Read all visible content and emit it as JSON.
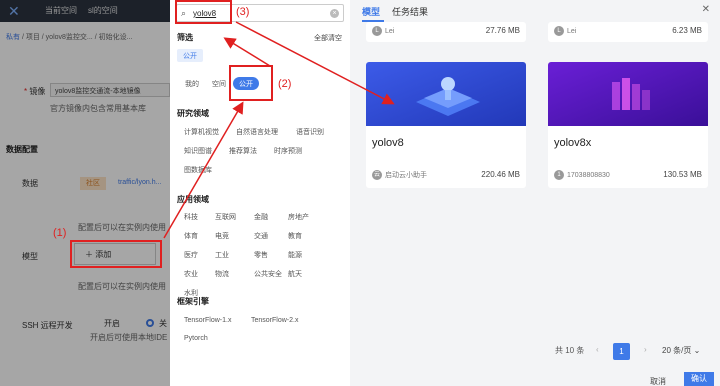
{
  "background": {
    "topnav": [
      "当前空间",
      "sl的空间"
    ],
    "breadcrumb": [
      "私有",
      "/ 项目",
      "/ yolov8监控交...",
      "/ 初始化设..."
    ],
    "image_label": "镜像",
    "image_value": "yolov8监控交通流-本地镜像",
    "image_hint": "官方镜像内包含常用基本库",
    "section_title": "数据配置",
    "data_label": "数据",
    "data_tag": "社区",
    "data_link": "traffic/lyon.h...",
    "data_hint": "配置后可以在实例内使用",
    "model_label": "模型",
    "model_add": "添加",
    "model_hint": "配置后可以在实例内使用",
    "ssh_label": "SSH 远程开发",
    "ssh_option": "开启",
    "ssh_option2": "关",
    "ssh_hint": "开启后可使用本地IDE"
  },
  "filter": {
    "search_value": "yolov8",
    "section_title": "筛选",
    "clear_all": "全部清空",
    "selected_chip": "公开",
    "scope_options": [
      "我的",
      "空间",
      "公开"
    ],
    "research_title": "研究领域",
    "research_items": [
      "计算机视觉",
      "自然语言处理",
      "语音识别",
      "知识图谱",
      "推荐算法",
      "时序预测",
      "图数据库"
    ],
    "application_title": "应用领域",
    "application_items": [
      "科技",
      "互联网",
      "金融",
      "房地产",
      "体育",
      "电竞",
      "交通",
      "教育",
      "医疗",
      "工业",
      "零售",
      "能源",
      "农业",
      "物流",
      "公共安全",
      "航天",
      "水利"
    ],
    "framework_title": "框架引擎",
    "framework_items": [
      "TensorFlow-1.x",
      "TensorFlow-2.x",
      "Pytorch"
    ]
  },
  "results": {
    "tabs": [
      "模型",
      "任务结果"
    ],
    "top_row": [
      {
        "user": "Lei",
        "size": "27.76 MB"
      },
      {
        "user": "Lei",
        "size": "6.23 MB"
      }
    ],
    "cards": [
      {
        "name": "yolov8",
        "user": "启动云小助手",
        "size": "220.46 MB"
      },
      {
        "name": "yolov8x",
        "user": "17038808830",
        "size": "130.53 MB"
      }
    ],
    "total": "共 10 条",
    "current_page": "1",
    "per_page": "20 条/页",
    "cancel": "取消",
    "confirm": "确认"
  },
  "annotations": [
    "(1)",
    "(2)",
    "(3)"
  ],
  "colors": {
    "accent": "#3f7ae8",
    "annotation": "#e02020"
  }
}
